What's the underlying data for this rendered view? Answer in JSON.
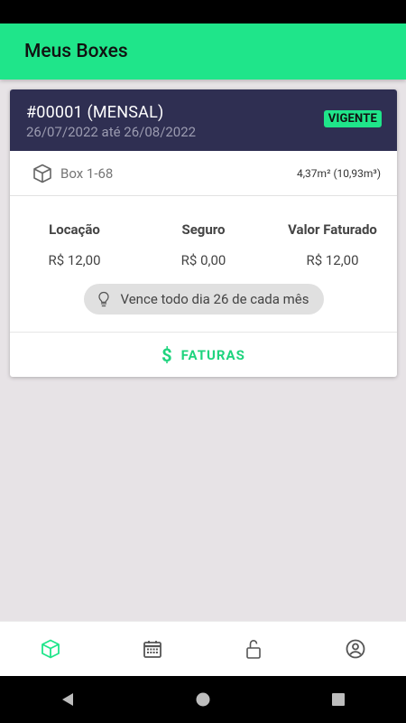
{
  "app": {
    "title": "Meus Boxes"
  },
  "contract": {
    "title": "#00001 (MENSAL)",
    "period": "26/07/2022 até 26/08/2022",
    "status": "VIGENTE",
    "box": {
      "icon": "cube-icon",
      "label": "Box 1-68",
      "area": "4,37m² (10,93m³)"
    },
    "values": [
      {
        "label": "Locação",
        "value": "R$ 12,00"
      },
      {
        "label": "Seguro",
        "value": "R$ 0,00"
      },
      {
        "label": "Valor Faturado",
        "value": "R$ 12,00"
      }
    ],
    "due_note": {
      "icon": "lightbulb-icon",
      "text": "Vence todo dia 26 de cada mês"
    },
    "invoices_button": {
      "icon": "dollar-icon",
      "label": "FATURAS"
    }
  },
  "bottom_nav": [
    {
      "icon": "box-icon",
      "active": true
    },
    {
      "icon": "calendar-icon",
      "active": false
    },
    {
      "icon": "unlock-icon",
      "active": false
    },
    {
      "icon": "account-icon",
      "active": false
    }
  ],
  "colors": {
    "accent": "#1fe58a",
    "header_bg": "#2f2f52",
    "page_bg": "#e7e3e6",
    "active_icon": "#1fe58a"
  }
}
